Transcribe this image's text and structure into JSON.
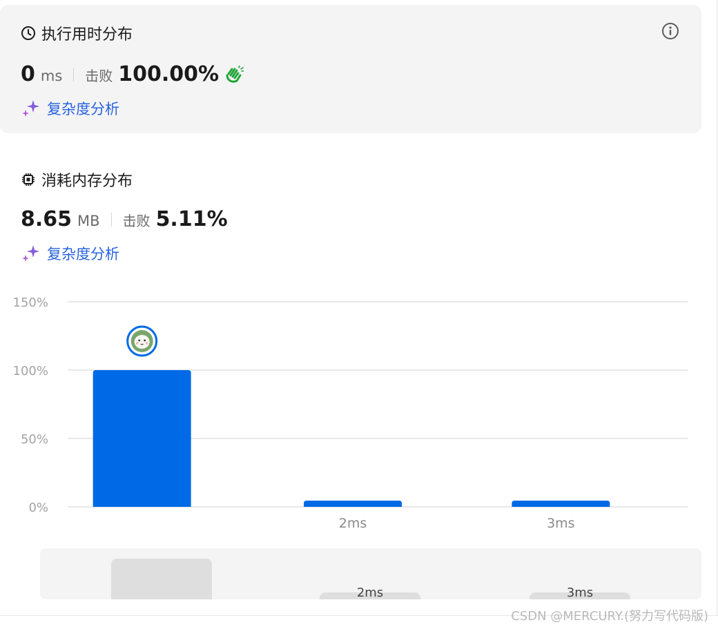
{
  "runtime": {
    "title": "执行用时分布",
    "value": "0",
    "unit": "ms",
    "beats_label": "击败",
    "beats_value": "100.00%",
    "complexity_link": "复杂度分析"
  },
  "memory": {
    "title": "消耗内存分布",
    "value": "8.65",
    "unit": "MB",
    "beats_label": "击败",
    "beats_value": "5.11%",
    "complexity_link": "复杂度分析"
  },
  "colors": {
    "bar": "#006ae6",
    "card_bg": "#f4f4f5",
    "link": "#2863e0",
    "clap": "#22a538"
  },
  "icons": [
    "clock-icon",
    "info-icon",
    "clap-icon",
    "sparkle-icon",
    "chip-icon",
    "avatar"
  ],
  "chart_data": {
    "type": "bar",
    "categories": [
      "",
      "2ms",
      "3ms"
    ],
    "values": [
      100,
      3,
      3
    ],
    "y_ticks": [
      "150%",
      "100%",
      "50%",
      "0%"
    ],
    "ylim": [
      0,
      150
    ],
    "grid": true,
    "highlighted_index": 0
  },
  "navigator": {
    "labels": [
      "",
      "2ms",
      "3ms"
    ]
  },
  "watermark": "CSDN @MERCURY.(努力写代码版)"
}
